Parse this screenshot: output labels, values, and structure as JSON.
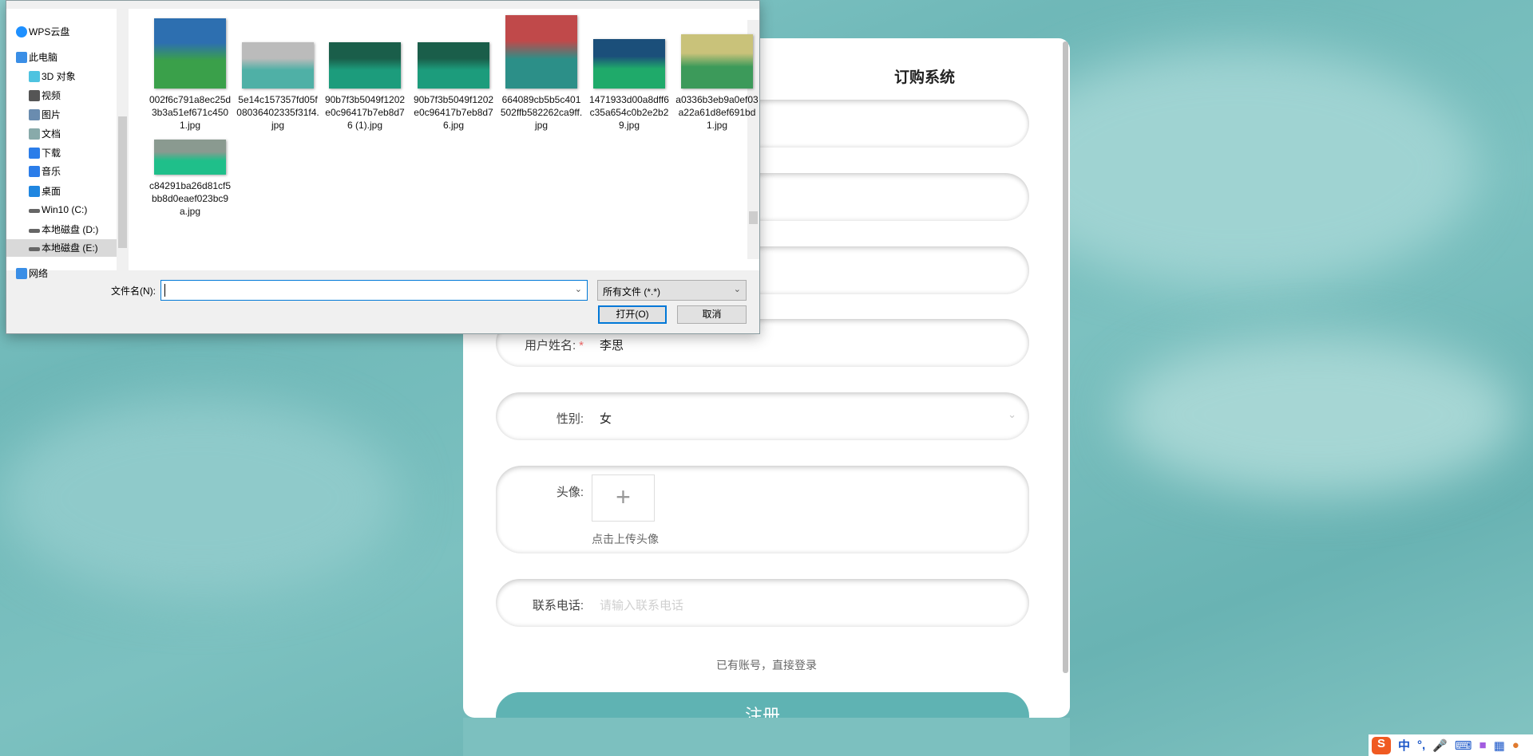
{
  "form": {
    "title": "订购系统",
    "fields": [
      {
        "label": "用户姓名:",
        "value": "李思",
        "required": true
      },
      {
        "label": "性别:",
        "value": "女"
      },
      {
        "label": "头像:",
        "upload_hint": "点击上传头像"
      },
      {
        "label": "联系电话:",
        "placeholder": "请输入联系电话"
      }
    ],
    "login_link": "已有账号，直接登录",
    "register_button": "注册",
    "accent": "#5fb3b3"
  },
  "dialog": {
    "nav": [
      {
        "label": "WPS云盘",
        "icon": "cloud-icon"
      },
      {
        "label": "此电脑",
        "icon": "computer-icon"
      },
      {
        "label": "3D 对象",
        "icon": "cube-icon"
      },
      {
        "label": "视频",
        "icon": "video-icon"
      },
      {
        "label": "图片",
        "icon": "picture-icon"
      },
      {
        "label": "文档",
        "icon": "document-icon"
      },
      {
        "label": "下载",
        "icon": "download-icon"
      },
      {
        "label": "音乐",
        "icon": "music-icon"
      },
      {
        "label": "桌面",
        "icon": "desktop-icon"
      },
      {
        "label": "Win10 (C:)",
        "icon": "drive-icon"
      },
      {
        "label": "本地磁盘 (D:)",
        "icon": "drive-icon"
      },
      {
        "label": "本地磁盘 (E:)",
        "icon": "drive-icon",
        "selected": true
      },
      {
        "label": "网络",
        "icon": "network-icon"
      }
    ],
    "files": [
      "002f6c791a8ec25d3b3a51ef671c4501.jpg",
      "5e14c157357fd05f08036402335f31f4.jpg",
      "90b7f3b5049f1202e0c96417b7eb8d76 (1).jpg",
      "90b7f3b5049f1202e0c96417b7eb8d76.jpg",
      "664089cb5b5c401502ffb582262ca9ff.jpg",
      "1471933d00a8dff6c35a654c0b2e2b29.jpg",
      "a0336b3eb9a0ef03a22a61d8ef691bd1.jpg",
      "c84291ba26d81cf5bb8d0eaef023bc9a.jpg"
    ],
    "filename_label": "文件名(N):",
    "filename_value": "",
    "filter": "所有文件 (*.*)",
    "open_button": "打开(O)",
    "cancel_button": "取消"
  },
  "ime": {
    "logo": "S",
    "mode": "中",
    "punct": "°,"
  }
}
